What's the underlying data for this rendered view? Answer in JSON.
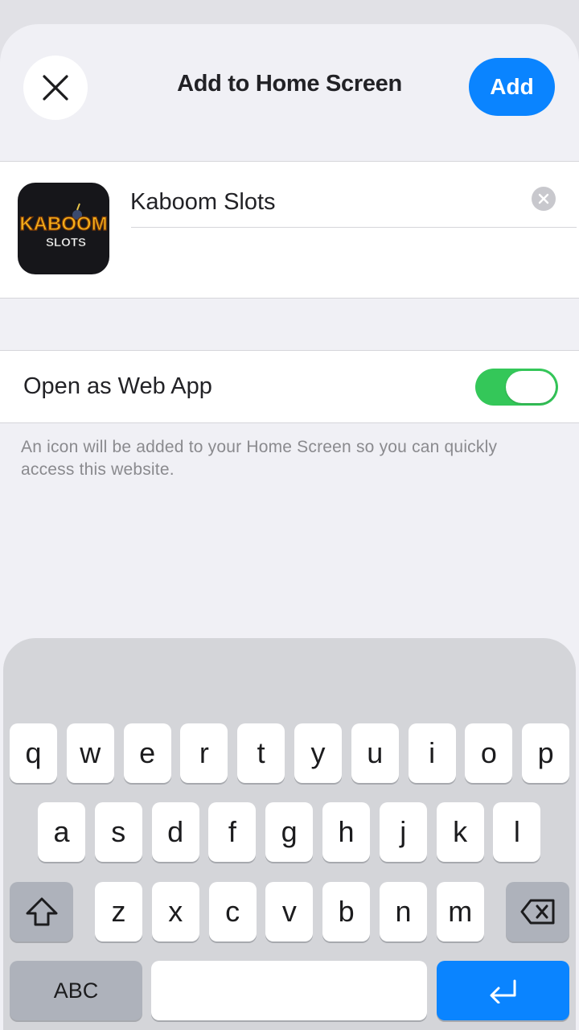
{
  "header": {
    "title": "Add to Home Screen",
    "add_label": "Add"
  },
  "app": {
    "name_value": "Kaboom Slots",
    "icon_text_top": "KABOOM",
    "icon_text_bottom": "SLOTS"
  },
  "webapp": {
    "label": "Open as Web App",
    "enabled": true
  },
  "footer_note": "An icon will be added to your Home Screen so you can quickly access this website.",
  "keyboard": {
    "row1": [
      "q",
      "w",
      "e",
      "r",
      "t",
      "y",
      "u",
      "i",
      "o",
      "p"
    ],
    "row2": [
      "a",
      "s",
      "d",
      "f",
      "g",
      "h",
      "j",
      "k",
      "l"
    ],
    "row3": [
      "z",
      "x",
      "c",
      "v",
      "b",
      "n",
      "m"
    ],
    "abc_label": "ABC"
  },
  "colors": {
    "accent": "#0a84ff",
    "toggle_on": "#34c759"
  }
}
